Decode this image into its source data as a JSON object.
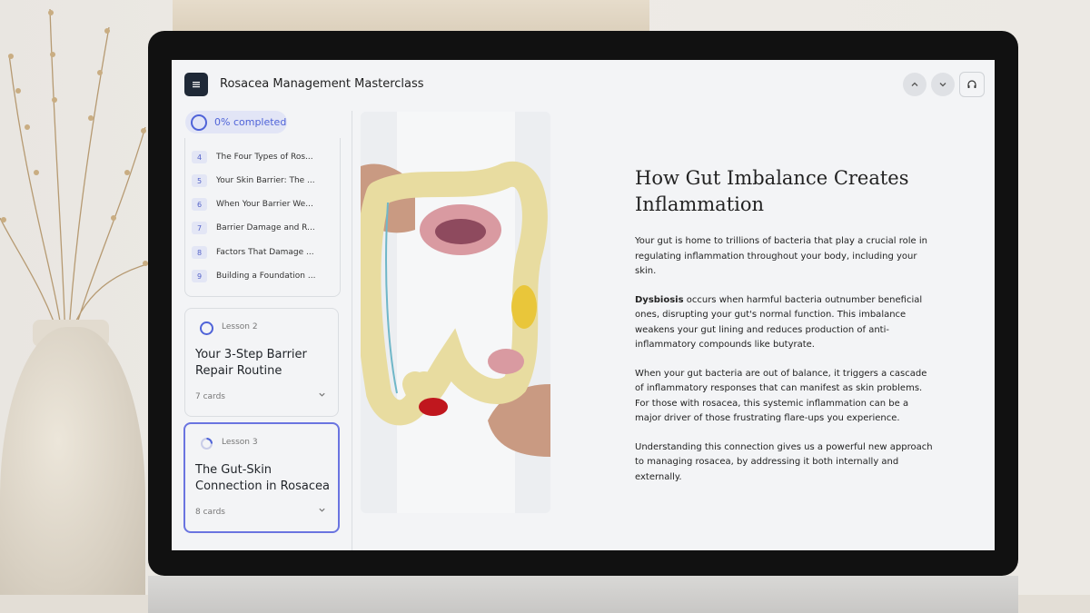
{
  "app": {
    "course_title": "Rosacea Management Masterclass"
  },
  "sidebar": {
    "progress": "0% completed",
    "cards": [
      {
        "num": "4",
        "title": "The Four Types of Ros..."
      },
      {
        "num": "5",
        "title": "Your Skin Barrier: The ..."
      },
      {
        "num": "6",
        "title": "When Your Barrier We..."
      },
      {
        "num": "7",
        "title": "Barrier Damage and R..."
      },
      {
        "num": "8",
        "title": "Factors That Damage ..."
      },
      {
        "num": "9",
        "title": "Building a Foundation ..."
      }
    ],
    "lessons": [
      {
        "label": "Lesson 2",
        "title": "Your 3-Step Barrier Repair Routine",
        "count": "7 cards"
      },
      {
        "label": "Lesson 3",
        "title": "The Gut-Skin Connection in Rosacea",
        "count": "8 cards"
      }
    ]
  },
  "content": {
    "heading": "How Gut Imbalance Creates Inflammation",
    "p1": "Your gut is home to trillions of bacteria that play a crucial role in regulating inflammation throughout your body, including your skin.",
    "p2_bold": "Dysbiosis",
    "p2_rest": " occurs when harmful bacteria outnumber beneficial ones, disrupting your gut's normal function. This imbalance weakens your gut lining and reduces production of anti-inflammatory compounds like butyrate.",
    "p3": "When your gut bacteria are out of balance, it triggers a cascade of inflammatory responses that can manifest as skin problems. For those with rosacea, this systemic inflammation can be a major driver of those frustrating flare-ups you experience.",
    "p4": "Understanding this connection gives us a powerful new approach to managing rosacea, by addressing it both internally and externally."
  },
  "icons": {
    "menu": "menu-icon",
    "up": "chevron-up-icon",
    "down": "chevron-down-icon",
    "audio": "headphones-icon"
  },
  "colors": {
    "accent": "#4f63d8",
    "menu_button": "#1f2937",
    "active_border": "#6a74e0"
  }
}
